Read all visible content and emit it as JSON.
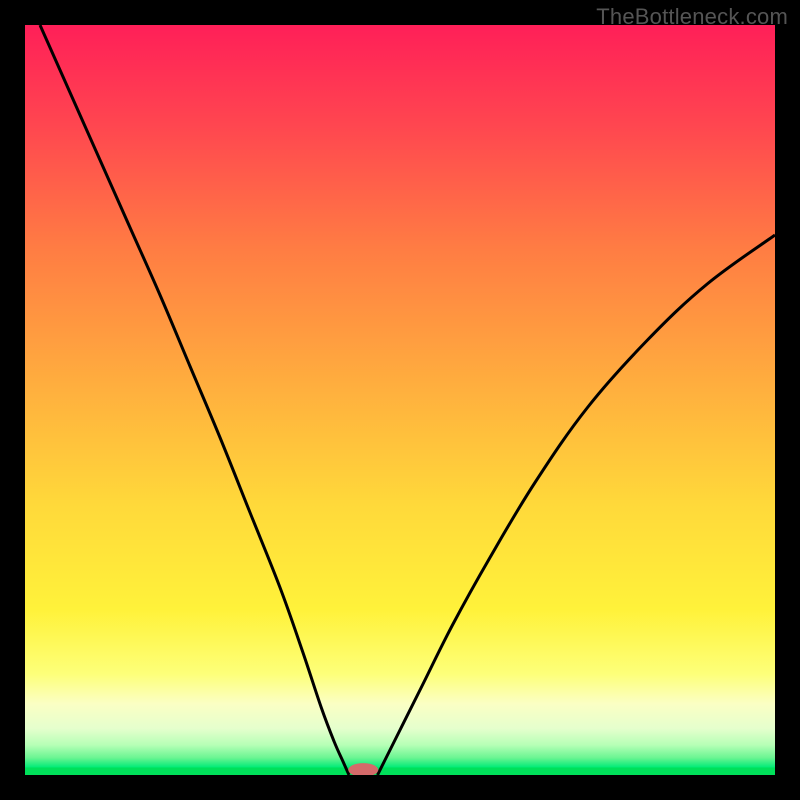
{
  "watermark": "TheBottleneck.com",
  "chart_data": {
    "type": "line",
    "title": "",
    "xlabel": "",
    "ylabel": "",
    "xlim": [
      0,
      1
    ],
    "ylim": [
      0,
      1
    ],
    "series": [
      {
        "name": "left-branch",
        "x": [
          0.02,
          0.06,
          0.1,
          0.14,
          0.18,
          0.22,
          0.26,
          0.3,
          0.34,
          0.37,
          0.395,
          0.412,
          0.424,
          0.432
        ],
        "y": [
          1.0,
          0.91,
          0.82,
          0.73,
          0.64,
          0.545,
          0.45,
          0.35,
          0.25,
          0.165,
          0.09,
          0.045,
          0.018,
          0.0
        ]
      },
      {
        "name": "right-branch",
        "x": [
          0.47,
          0.48,
          0.5,
          0.53,
          0.57,
          0.62,
          0.68,
          0.75,
          0.83,
          0.91,
          1.0
        ],
        "y": [
          0.0,
          0.02,
          0.06,
          0.12,
          0.2,
          0.29,
          0.39,
          0.49,
          0.58,
          0.655,
          0.72
        ]
      }
    ],
    "marker": {
      "x": 0.451,
      "y": 0.0,
      "color": "#d46a6a",
      "rx": 0.02,
      "ry": 0.009
    },
    "baseline": {
      "y": 0.0,
      "color": "#00e05a",
      "thickness": 0.01
    },
    "gradient_stops": [
      {
        "offset": 0.0,
        "color": "#ff1f58"
      },
      {
        "offset": 0.13,
        "color": "#ff4550"
      },
      {
        "offset": 0.3,
        "color": "#ff7d43"
      },
      {
        "offset": 0.48,
        "color": "#ffae3e"
      },
      {
        "offset": 0.64,
        "color": "#ffd93a"
      },
      {
        "offset": 0.78,
        "color": "#fff23a"
      },
      {
        "offset": 0.865,
        "color": "#fdff79"
      },
      {
        "offset": 0.905,
        "color": "#fbffc4"
      },
      {
        "offset": 0.938,
        "color": "#e5ffcd"
      },
      {
        "offset": 0.96,
        "color": "#b6ffb6"
      },
      {
        "offset": 0.977,
        "color": "#6af592"
      },
      {
        "offset": 0.99,
        "color": "#00eb77"
      }
    ]
  }
}
